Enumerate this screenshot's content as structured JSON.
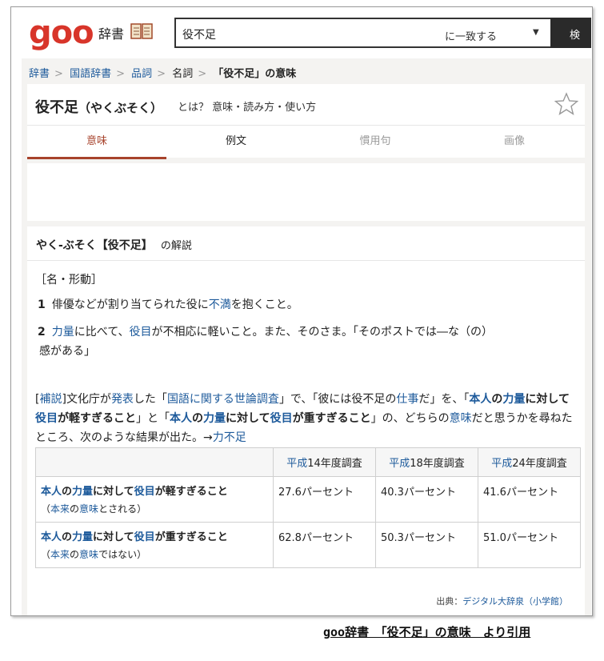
{
  "header": {
    "logo": "goo",
    "service": "辞書",
    "search_value": "役不足",
    "match_mode": "に一致する",
    "search_button": "検"
  },
  "breadcrumb": [
    "辞書",
    "国語辞書",
    "品詞",
    "名詞",
    "「役不足」の意味"
  ],
  "title": {
    "word": "役不足",
    "reading": "（やくぶそく）",
    "suffix": "とは？ 意味・読み方・使い方"
  },
  "tabs": [
    "意味",
    "例文",
    "慣用句",
    "画像"
  ],
  "entry": {
    "heading": "やく-ぶそく【役不足】",
    "heading_suffix": "の解説",
    "pos": "［名・形動］",
    "def1_num": "1",
    "def1_a": "俳優などが割り当てられた役に",
    "def1_link": "不満",
    "def1_b": "を抱くこと。",
    "def2_num": "2",
    "def2_link1": "力量",
    "def2_a": "に比べて、",
    "def2_link2": "役目",
    "def2_b": "が不相応に軽いこと。また、そのさま。「そのポストでは―な（の）",
    "def2_c": "感がある」"
  },
  "note": {
    "hosetsu": "補説",
    "t1": "文化庁が",
    "l1": "発表",
    "t2": "した「",
    "l2": "国語に関する世論調査",
    "t3": "」で、「彼には役不足の",
    "l3": "仕事",
    "t4": "だ」を、「",
    "b1": "本人",
    "b2": "の",
    "b3": "力量",
    "b4": "に対して",
    "b5": "役目",
    "b6": "が軽すぎること",
    "t5": "」と「",
    "b7": "本人",
    "b8": "の",
    "b9": "力量",
    "b10": "に対して",
    "b11": "役目",
    "b12": "が重すぎること",
    "t6": "」の、どちらの",
    "l4": "意味",
    "t7": "だと思うかを尋ねたところ、次のような結果が出た。→",
    "l5": "力不足"
  },
  "table": {
    "headers": [
      {
        "era": "平成",
        "rest": "14年度調査"
      },
      {
        "era": "平成",
        "rest": "18年度調査"
      },
      {
        "era": "平成",
        "rest": "24年度調査"
      }
    ],
    "rows": [
      {
        "w1": "本人",
        "w2": "の",
        "w3": "力量",
        "w4": "に対して",
        "w5": "役目",
        "w6": "が軽すぎること",
        "s1": "（",
        "s2": "本来",
        "s3": "の",
        "s4": "意味",
        "s5": "とされる）",
        "values": [
          "27.6パーセント",
          "40.3パーセント",
          "41.6パーセント"
        ]
      },
      {
        "w1": "本人",
        "w2": "の",
        "w3": "力量",
        "w4": "に対して",
        "w5": "役目",
        "w6": "が重すぎること",
        "s1": "（",
        "s2": "本来",
        "s3": "の",
        "s4": "意味",
        "s5": "ではない）",
        "values": [
          "62.8パーセント",
          "50.3パーセント",
          "51.0パーセント"
        ]
      }
    ]
  },
  "source": {
    "label": "出典：",
    "link": "デジタル大辞泉（小学館）"
  },
  "caption": "goo辞書　「役不足」の意味　より引用",
  "colors": {
    "logo_red": "#d8352a",
    "link_blue": "#1d5a9b",
    "tab_active": "#a7432c"
  }
}
